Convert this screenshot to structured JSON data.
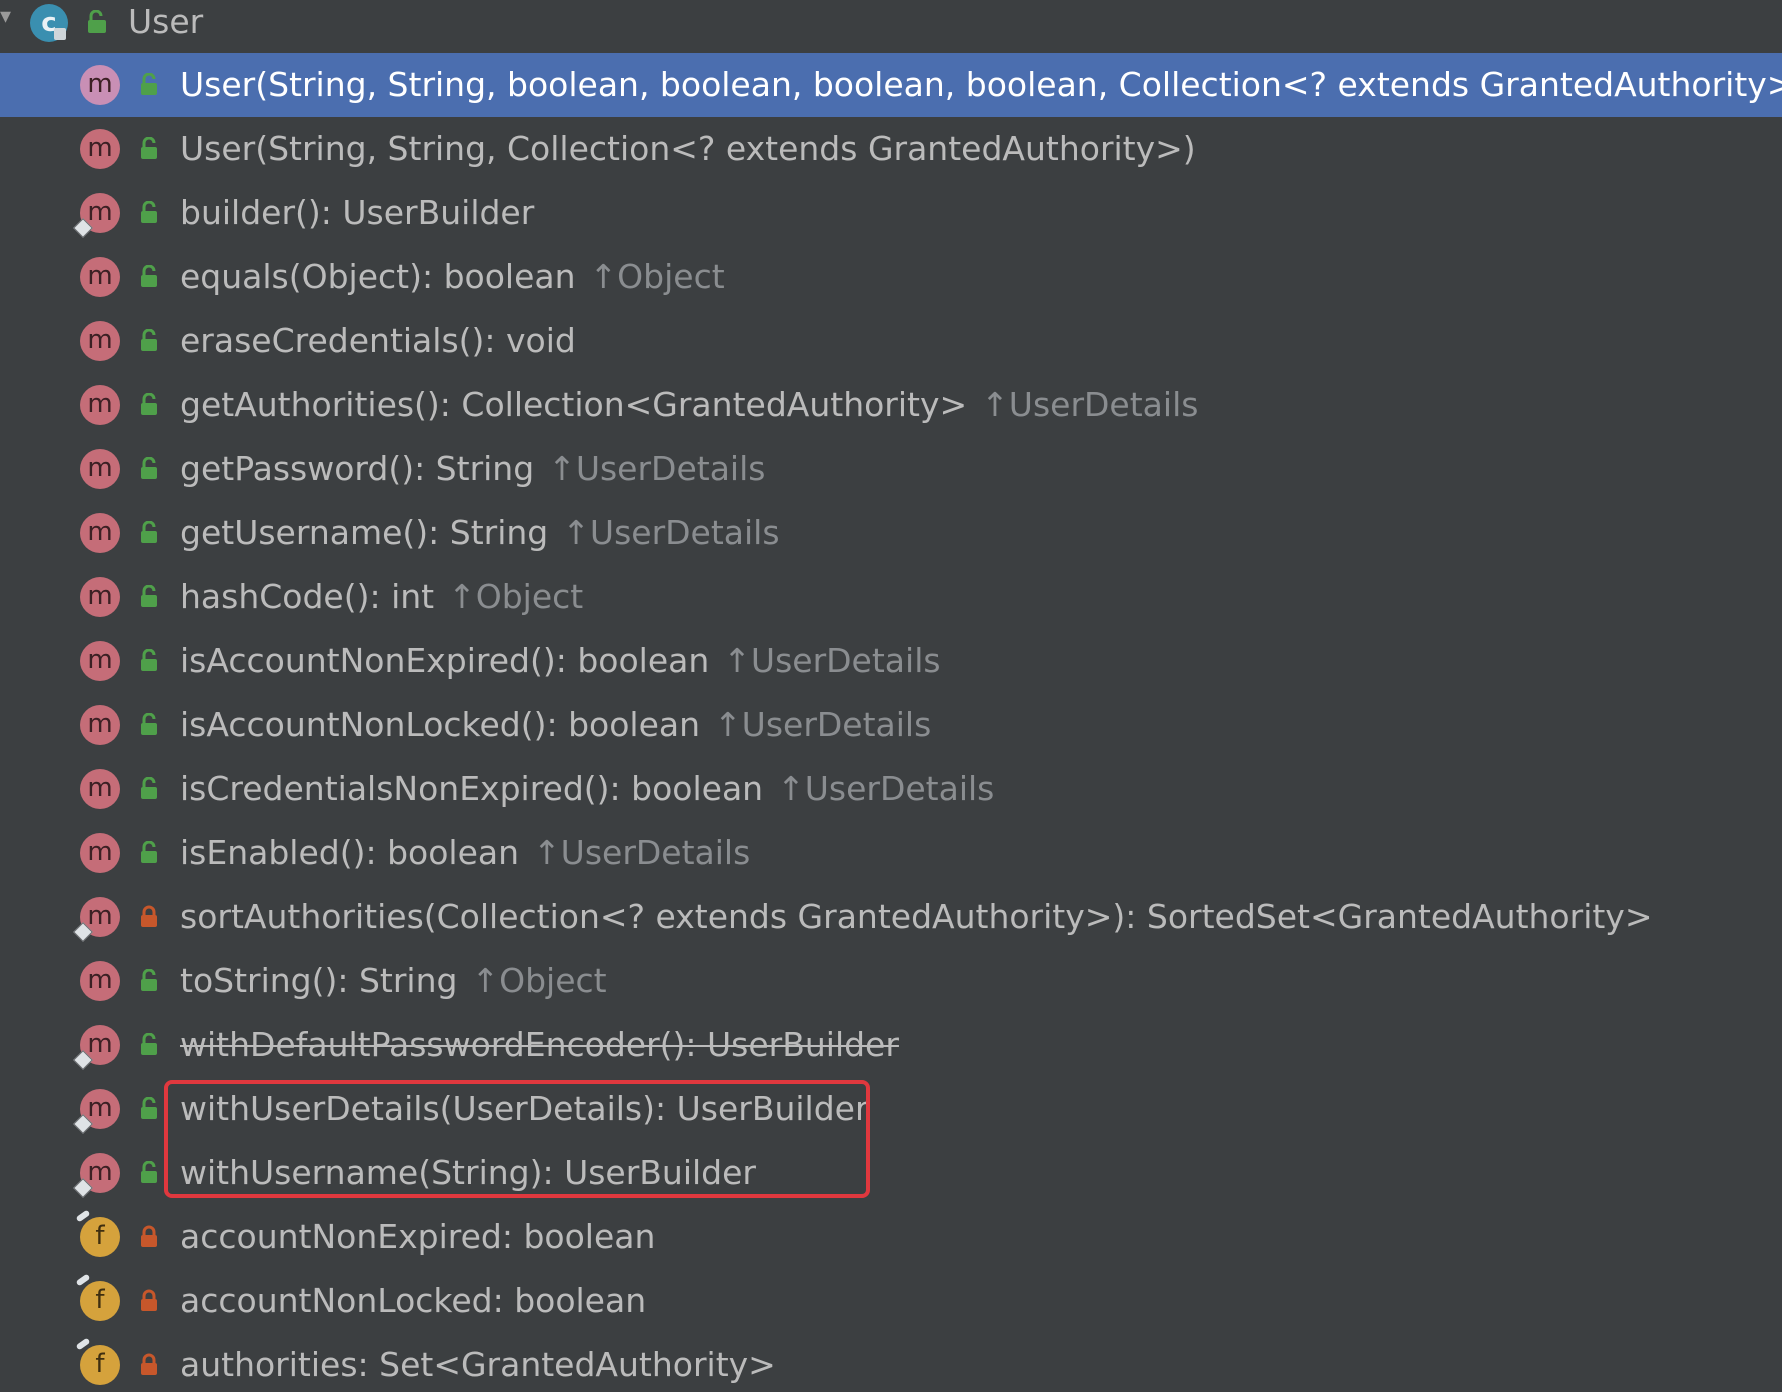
{
  "root": {
    "label": "User",
    "class_icon_letter": "c",
    "icon": "class-icon"
  },
  "colors": {
    "selection": "#4b6eaf",
    "method_icon": "#c56d78",
    "field_icon": "#d5a23c",
    "public_icon": "#4fa04a",
    "private_icon": "#c7572b",
    "highlight_box": "#e0383e"
  },
  "rows": [
    {
      "kind": "method",
      "icon_letter": "m",
      "visibility": "public",
      "static": false,
      "selected": true,
      "deprecated": false,
      "signature": "User(String, String, boolean, boolean, boolean, boolean, Collection<? extends GrantedAuthority>)",
      "origin": ""
    },
    {
      "kind": "method",
      "icon_letter": "m",
      "visibility": "public",
      "static": false,
      "selected": false,
      "deprecated": false,
      "signature": "User(String, String, Collection<? extends GrantedAuthority>)",
      "origin": ""
    },
    {
      "kind": "method",
      "icon_letter": "m",
      "visibility": "public",
      "static": true,
      "selected": false,
      "deprecated": false,
      "signature": "builder(): UserBuilder",
      "origin": ""
    },
    {
      "kind": "method",
      "icon_letter": "m",
      "visibility": "public",
      "static": false,
      "selected": false,
      "deprecated": false,
      "signature": "equals(Object): boolean",
      "origin": "↑Object"
    },
    {
      "kind": "method",
      "icon_letter": "m",
      "visibility": "public",
      "static": false,
      "selected": false,
      "deprecated": false,
      "signature": "eraseCredentials(): void",
      "origin": ""
    },
    {
      "kind": "method",
      "icon_letter": "m",
      "visibility": "public",
      "static": false,
      "selected": false,
      "deprecated": false,
      "signature": "getAuthorities(): Collection<GrantedAuthority>",
      "origin": "↑UserDetails"
    },
    {
      "kind": "method",
      "icon_letter": "m",
      "visibility": "public",
      "static": false,
      "selected": false,
      "deprecated": false,
      "signature": "getPassword(): String",
      "origin": "↑UserDetails"
    },
    {
      "kind": "method",
      "icon_letter": "m",
      "visibility": "public",
      "static": false,
      "selected": false,
      "deprecated": false,
      "signature": "getUsername(): String",
      "origin": "↑UserDetails"
    },
    {
      "kind": "method",
      "icon_letter": "m",
      "visibility": "public",
      "static": false,
      "selected": false,
      "deprecated": false,
      "signature": "hashCode(): int",
      "origin": "↑Object"
    },
    {
      "kind": "method",
      "icon_letter": "m",
      "visibility": "public",
      "static": false,
      "selected": false,
      "deprecated": false,
      "signature": "isAccountNonExpired(): boolean",
      "origin": "↑UserDetails"
    },
    {
      "kind": "method",
      "icon_letter": "m",
      "visibility": "public",
      "static": false,
      "selected": false,
      "deprecated": false,
      "signature": "isAccountNonLocked(): boolean",
      "origin": "↑UserDetails"
    },
    {
      "kind": "method",
      "icon_letter": "m",
      "visibility": "public",
      "static": false,
      "selected": false,
      "deprecated": false,
      "signature": "isCredentialsNonExpired(): boolean",
      "origin": "↑UserDetails"
    },
    {
      "kind": "method",
      "icon_letter": "m",
      "visibility": "public",
      "static": false,
      "selected": false,
      "deprecated": false,
      "signature": "isEnabled(): boolean",
      "origin": "↑UserDetails"
    },
    {
      "kind": "method",
      "icon_letter": "m",
      "visibility": "private",
      "static": true,
      "selected": false,
      "deprecated": false,
      "signature": "sortAuthorities(Collection<? extends GrantedAuthority>): SortedSet<GrantedAuthority>",
      "origin": ""
    },
    {
      "kind": "method",
      "icon_letter": "m",
      "visibility": "public",
      "static": false,
      "selected": false,
      "deprecated": false,
      "signature": "toString(): String",
      "origin": "↑Object"
    },
    {
      "kind": "method",
      "icon_letter": "m",
      "visibility": "public",
      "static": true,
      "selected": false,
      "deprecated": true,
      "signature": "withDefaultPasswordEncoder(): UserBuilder",
      "origin": ""
    },
    {
      "kind": "method",
      "icon_letter": "m",
      "visibility": "public",
      "static": true,
      "selected": false,
      "deprecated": false,
      "signature": "withUserDetails(UserDetails): UserBuilder",
      "origin": ""
    },
    {
      "kind": "method",
      "icon_letter": "m",
      "visibility": "public",
      "static": true,
      "selected": false,
      "deprecated": false,
      "signature": "withUsername(String): UserBuilder",
      "origin": ""
    },
    {
      "kind": "field",
      "icon_letter": "f",
      "visibility": "private",
      "static": false,
      "final": true,
      "selected": false,
      "deprecated": false,
      "signature": "accountNonExpired: boolean",
      "origin": ""
    },
    {
      "kind": "field",
      "icon_letter": "f",
      "visibility": "private",
      "static": false,
      "final": true,
      "selected": false,
      "deprecated": false,
      "signature": "accountNonLocked: boolean",
      "origin": ""
    },
    {
      "kind": "field",
      "icon_letter": "f",
      "visibility": "private",
      "static": false,
      "final": true,
      "selected": false,
      "deprecated": false,
      "signature": "authorities: Set<GrantedAuthority>",
      "origin": ""
    }
  ]
}
